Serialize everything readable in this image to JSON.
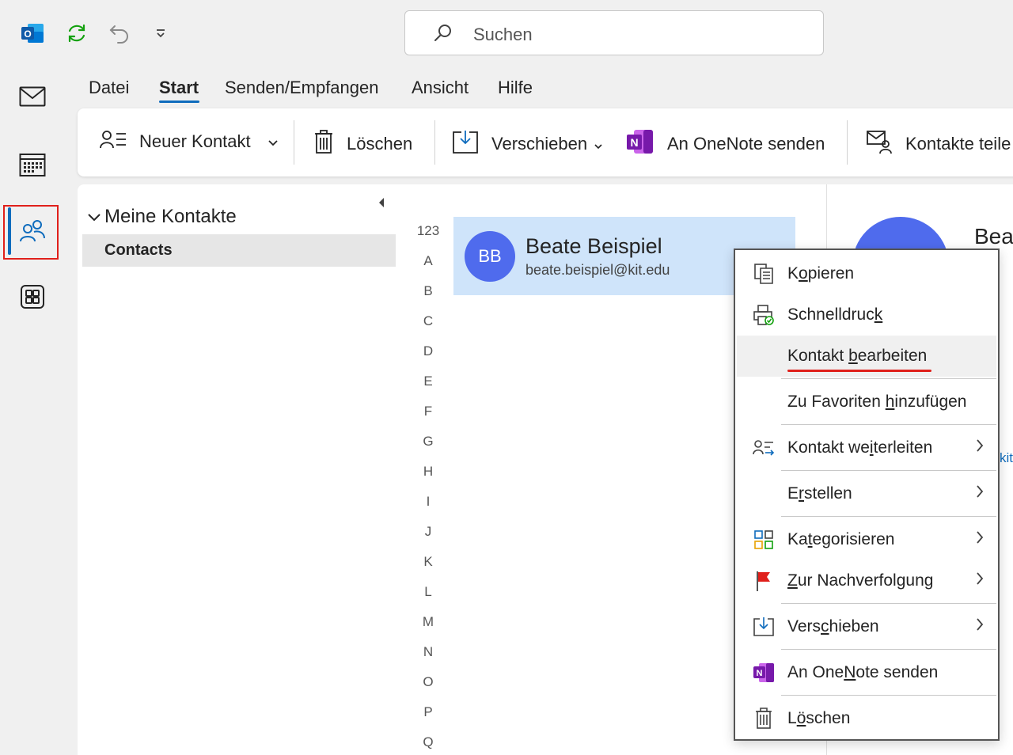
{
  "search": {
    "placeholder": "Suchen"
  },
  "menu_tabs": [
    {
      "label": "Datei"
    },
    {
      "label": "Start",
      "active": true
    },
    {
      "label": "Senden/Empfangen"
    },
    {
      "label": "Ansicht"
    },
    {
      "label": "Hilfe"
    }
  ],
  "ribbon": {
    "new_contact": "Neuer Kontakt",
    "delete": "Löschen",
    "move": "Verschieben",
    "onenote": "An OneNote senden",
    "share_contacts": "Kontakte teile"
  },
  "folder_pane": {
    "group_title": "Meine Kontakte",
    "folders": [
      "Contacts"
    ]
  },
  "alphabet_index": [
    "123",
    "A",
    "B",
    "C",
    "D",
    "E",
    "F",
    "G",
    "H",
    "I",
    "J",
    "K",
    "L",
    "M",
    "N",
    "O",
    "P",
    "Q"
  ],
  "contact": {
    "initials": "BB",
    "name": "Beate Beispiel",
    "email": "beate.beispiel@kit.edu"
  },
  "reading_pane": {
    "name_partial": "Bea",
    "email_partial": "kit"
  },
  "context_menu": {
    "items": [
      {
        "pre": "K",
        "acc": "o",
        "post": "pieren",
        "icon": "copy-icon"
      },
      {
        "pre": "Schnelldruc",
        "acc": "k",
        "post": "",
        "icon": "quick-print-icon"
      },
      {
        "pre": "Kontakt ",
        "acc": "b",
        "post": "earbeiten",
        "icon": "",
        "highlighted": true
      },
      {
        "pre": "Zu Favoriten ",
        "acc": "h",
        "post": "inzufügen",
        "icon": ""
      },
      {
        "pre": "Kontakt we",
        "acc": "i",
        "post": "terleiten",
        "icon": "forward-contact-icon",
        "submenu": true
      },
      {
        "pre": "E",
        "acc": "r",
        "post": "stellen",
        "icon": "",
        "submenu": true
      },
      {
        "pre": "Ka",
        "acc": "t",
        "post": "egorisieren",
        "icon": "categorize-icon",
        "submenu": true
      },
      {
        "pre": "",
        "acc": "Z",
        "post": "ur Nachverfolgung",
        "icon": "flag-icon",
        "submenu": true
      },
      {
        "pre": "Vers",
        "acc": "c",
        "post": "hieben",
        "icon": "move-icon",
        "submenu": true
      },
      {
        "pre": "An One",
        "acc": "N",
        "post": "ote senden",
        "icon": "onenote-icon"
      },
      {
        "pre": "L",
        "acc": "ö",
        "post": "schen",
        "icon": "delete-icon"
      }
    ]
  },
  "colors": {
    "accent": "#0f6cbd",
    "avatar": "#4f6bed",
    "selection": "#cfe4fa",
    "highlight_red": "#e0201b"
  }
}
